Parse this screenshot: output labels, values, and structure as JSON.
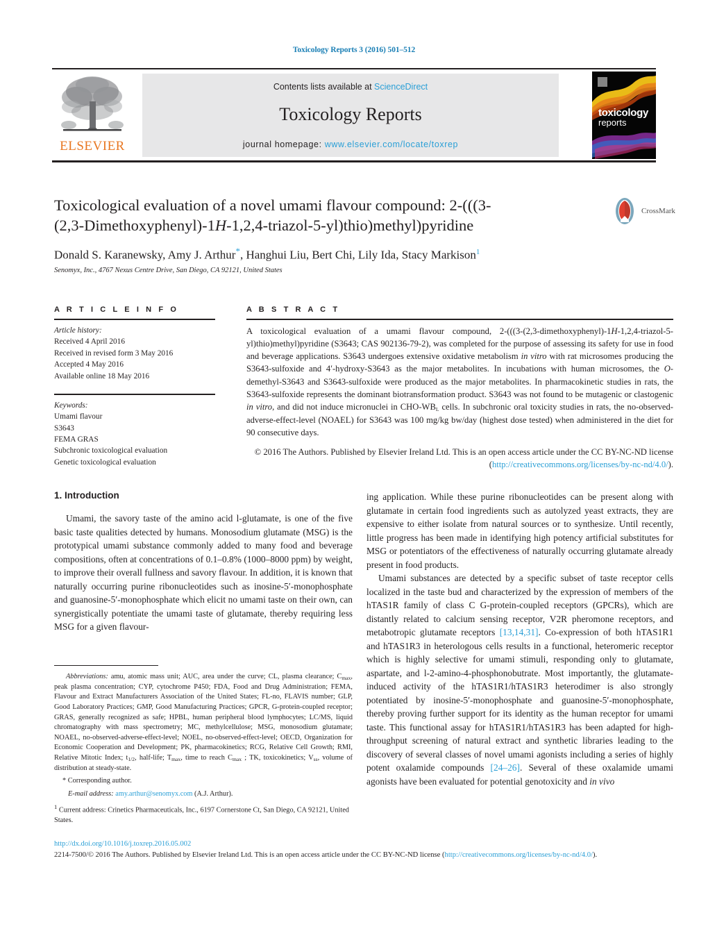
{
  "colors": {
    "link": "#2a9fd6",
    "elsevier_orange": "#e87722",
    "text": "#231f20",
    "masthead_grey": "#e7e7e8"
  },
  "running_head": "Toxicology Reports 3 (2016) 501–512",
  "masthead": {
    "contents_prefix": "Contents lists available at ",
    "sciencedirect": "ScienceDirect",
    "journal_title": "Toxicology Reports",
    "homepage_prefix": "journal homepage: ",
    "homepage_url": "www.elsevier.com/locate/toxrep",
    "publisher": "ELSEVIER",
    "cover_line1": "toxicology",
    "cover_line2": "reports"
  },
  "article": {
    "title_line1": "Toxicological evaluation of a novel umami flavour compound: 2-(((3-",
    "title_line2_a": "(2,3-Dimethoxyphenyl)-1",
    "title_line2_italic": "H",
    "title_line2_b": "-1,2,4-triazol-5-yl)thio)methyl)pyridine",
    "authors_a": "Donald S. Karanewsky, Amy J. Arthur",
    "authors_star": "*",
    "authors_b": ", Hanghui Liu, Bert Chi, Lily Ida, Stacy Markison",
    "authors_sup": "1",
    "affiliation": "Senomyx, Inc., 4767 Nexus Centre Drive, San Diego, CA 92121, United States",
    "crossmark_label": "CrossMark"
  },
  "info": {
    "heading": "A R T I C L E   I N F O",
    "history_label": "Article history:",
    "history": [
      "Received 4 April 2016",
      "Received in revised form 3 May 2016",
      "Accepted 4 May 2016",
      "Available online 18 May 2016"
    ],
    "keywords_label": "Keywords:",
    "keywords": [
      "Umami flavour",
      "S3643",
      "FEMA GRAS",
      "Subchronic toxicological evaluation",
      "Genetic toxicological evaluation"
    ]
  },
  "abstract": {
    "heading": "A B S T R A C T",
    "p1_a": "A toxicological evaluation of a umami flavour compound, 2-(((3-(2,3-dimethoxyphenyl)-1",
    "p1_italic1": "H",
    "p1_b": "-1,2,4-triazol-5-yl)thio)methyl)pyridine (S3643; CAS 902136-79-2), was completed for the purpose of assessing its safety for use in food and beverage applications. S3643 undergoes extensive oxidative metabolism ",
    "p1_italic2": "in vitro",
    "p1_c": " with rat microsomes producing the S3643-sulfoxide and 4′-hydroxy-S3643 as the major metabolites. In incubations with human microsomes, the ",
    "p1_italic3": "O",
    "p1_d": "-demethyl-S3643 and S3643-sulfoxide were produced as the major metabolites. In pharmacokinetic studies in rats, the S3643-sulfoxide represents the dominant biotransformation product. S3643 was not found to be mutagenic or clastogenic ",
    "p1_italic4": "in vitro",
    "p1_e": ", and did not induce micronuclei in CHO-WB",
    "p1_sub": "L",
    "p1_f": " cells. In subchronic oral toxicity studies in rats, the no-observed-adverse-effect-level (NOAEL) for S3643 was 100 mg/kg bw/day (highest dose tested) when administered in the diet for 90 consecutive days.",
    "copyright_a": "© 2016 The Authors. Published by Elsevier Ireland Ltd. This is an open access article under the CC BY-NC-ND license (",
    "copyright_link": "http://creativecommons.org/licenses/by-nc-nd/4.0/",
    "copyright_b": ")."
  },
  "body": {
    "section_heading": "1. Introduction",
    "left_p1_a": "Umami, the savory taste of the amino acid ",
    "left_p1_smallcap": "l",
    "left_p1_b": "-glutamate, is one of the five basic taste qualities detected by humans. Monosodium glutamate (MSG) is the prototypical umami substance commonly added to many food and beverage compositions, often at concentrations of 0.1–0.8% (1000–8000 ppm) by weight, to improve their overall fullness and savory flavour. In addition, it is known that naturally occurring purine ribonucleotides such as inosine-5′-monophosphate and guanosine-5′-monophosphate which elicit no umami taste on their own, can synergistically potentiate the umami taste of glutamate, thereby requiring less MSG for a given flavour-",
    "right_p1": "ing application. While these purine ribonucleotides can be present along with glutamate in certain food ingredients such as autolyzed yeast extracts, they are expensive to either isolate from natural sources or to synthesize. Until recently, little progress has been made in identifying high potency artificial substitutes for MSG or potentiators of the effectiveness of naturally occurring glutamate already present in food products.",
    "right_p2_a": "Umami substances are detected by a specific subset of taste receptor cells localized in the taste bud and characterized by the expression of members of the hTAS1R family of class C G-protein-coupled receptors (GPCRs), which are distantly related to calcium sensing receptor, V2R pheromone receptors, and metabotropic glutamate receptors ",
    "right_p2_ref1": "[13,14,31]",
    "right_p2_b": ". Co-expression of both hTAS1R1 and hTAS1R3 in heterologous cells results in a functional, heteromeric receptor which is highly selective for umami stimuli, responding only to glutamate, aspartate, and ",
    "right_p2_smallcap": "l",
    "right_p2_c": "-2-amino-4-phosphonobutrate. Most importantly, the glutamate-induced activity of the hTAS1R1/hTAS1R3 heterodimer is also strongly potentiated by inosine-5′-monophosphate and guanosine-5′-monophosphate, thereby proving further support for its identity as the human receptor for umami taste. This functional assay for hTAS1R1/hTAS1R3 has been adapted for high-throughput screening of natural extract and synthetic libraries leading to the discovery of several classes of novel umami agonists including a series of highly potent oxalamide compounds ",
    "right_p2_ref2": "[24–26]",
    "right_p2_d": ". Several of these oxalamide umami agonists have been evaluated for potential genotoxicity and ",
    "right_p2_italic": "in vivo"
  },
  "footnotes": {
    "abbrev_label": "Abbreviations:",
    "abbrev_a": " amu, atomic mass unit; AUC, area under the curve; CL, plasma clearance; C",
    "abbrev_sub1": "max",
    "abbrev_b": ", peak plasma concentration; CYP, cytochrome P450; FDA, Food and Drug Administration; FEMA, Flavour and Extract Manufacturers Association of the United States; FL-no, FLAVIS number; GLP, Good Laboratory Practices; GMP, Good Manufacturing Practices; GPCR, G-protein-coupled receptor; GRAS, generally recognized as safe; HPBL, human peripheral blood lymphocytes; LC/MS, liquid chromatography with mass spectrometry; MC, methylcellulose; MSG, monosodium glutamate; NOAEL, no-observed-adverse-effect-level; NOEL, no-observed-effect-level; OECD, Organization for Economic Cooperation and Development; PK, pharmacokinetics; RCG, Relative Cell Growth; RMI, Relative Mitotic Index; t",
    "abbrev_sub2": "1/2",
    "abbrev_c": ", half-life; T",
    "abbrev_sub3": "max",
    "abbrev_d": ", time to reach C",
    "abbrev_sub4": "max",
    "abbrev_e": " ; TK, toxicokinetics; V",
    "abbrev_sub5": "ss",
    "abbrev_f": ", volume of distribution at steady-state.",
    "corresponding_marker": "*",
    "corresponding": " Corresponding author.",
    "email_label": "E-mail address:",
    "email": "amy.arthur@senomyx.com",
    "email_suffix": " (A.J. Arthur).",
    "current_marker": "1",
    "current_address": " Current address: Crinetics Pharmaceuticals, Inc., 6197 Cornerstone Ct, San Diego, CA 92121, United States."
  },
  "page_footer": {
    "doi": "http://dx.doi.org/10.1016/j.toxrep.2016.05.002",
    "issn_a": "2214-7500/© 2016 The Authors. Published by Elsevier Ireland Ltd. This is an open access article under the CC BY-NC-ND license (",
    "issn_link": "http://creativecommons.org/licenses/by-nc-nd/4.0/",
    "issn_b": ")."
  }
}
